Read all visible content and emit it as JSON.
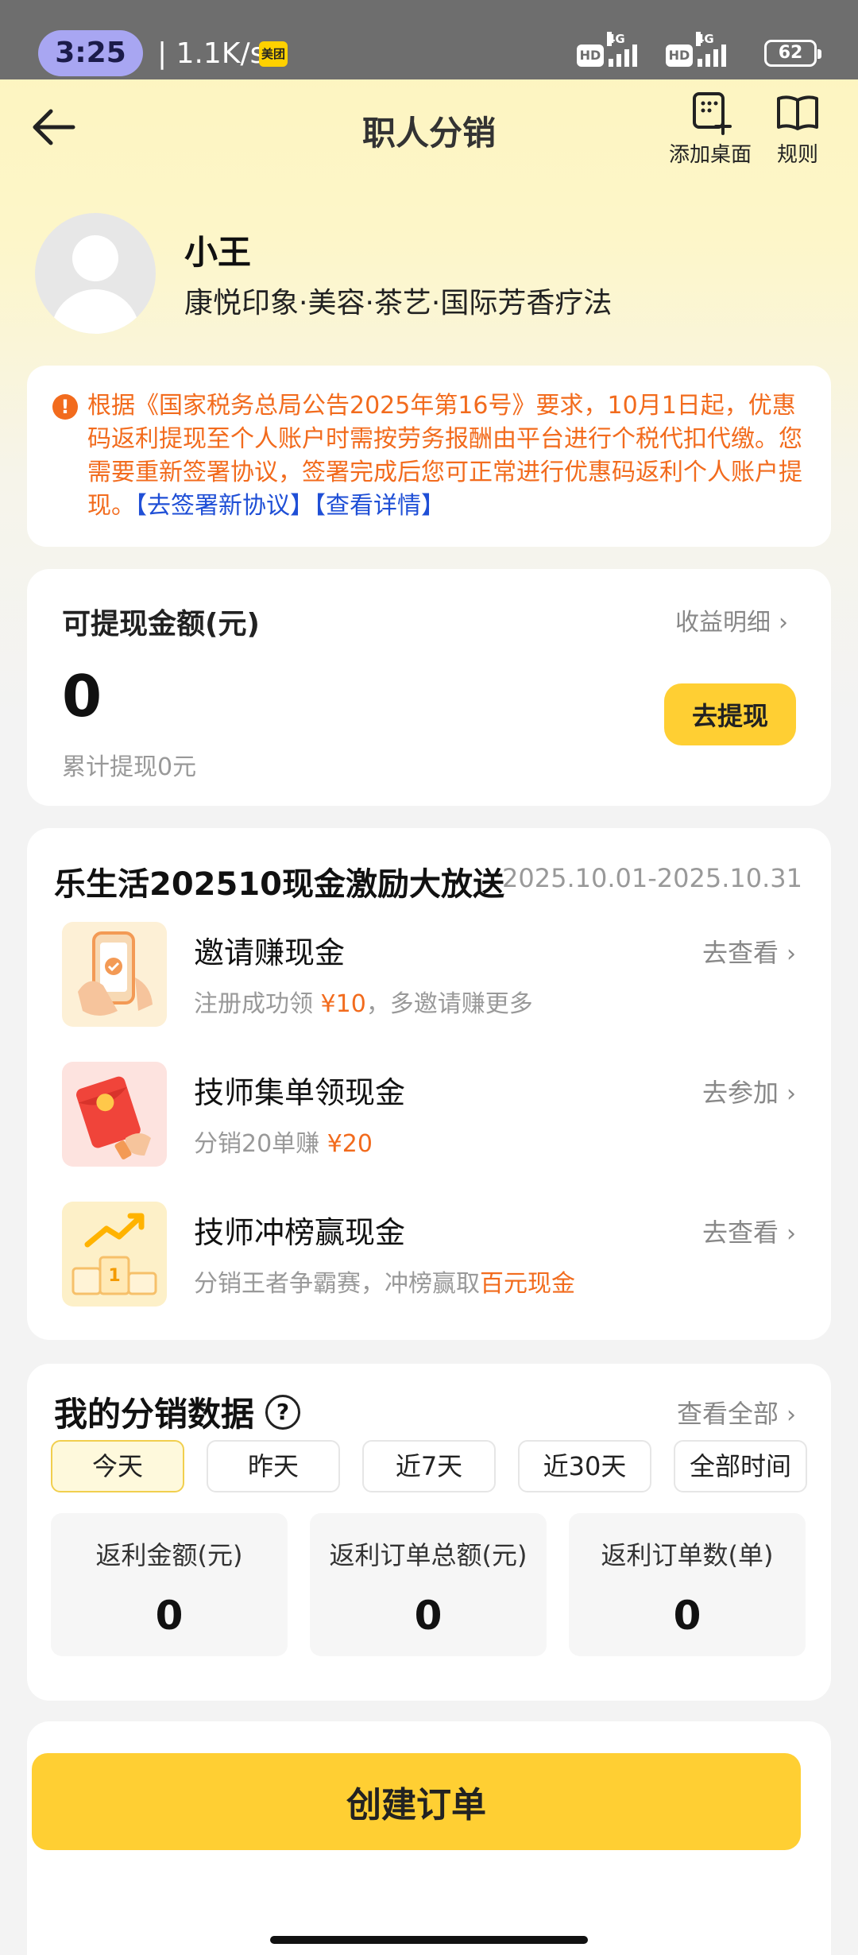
{
  "status_bar": {
    "time": "3:25",
    "net_speed": "1.1K/s",
    "app_badge": "美团",
    "hd_label": "HD",
    "network_label": "4G",
    "battery": "62"
  },
  "header": {
    "title": "职人分销",
    "add_desktop_label": "添加桌面",
    "rules_label": "规则"
  },
  "profile": {
    "name": "小王",
    "tags": "康悦印象·美容·茶艺·国际芳香疗法"
  },
  "notice": {
    "text": "根据《国家税务总局公告2025年第16号》要求，10月1日起，优惠码返利提现至个人账户时需按劳务报酬由平台进行个税代扣代缴。您需要重新签署协议，签署完成后您可正常进行优惠码返利个人账户提现。",
    "sign_link": "【去签署新协议】",
    "detail_link": "【查看详情】"
  },
  "withdraw": {
    "title": "可提现金额(元)",
    "detail_link": "收益明细",
    "amount": "0",
    "total_text": "累计提现0元",
    "button_label": "去提现"
  },
  "campaign": {
    "title": "乐生活202510现金激励大放送",
    "date_range": "2025.10.01-2025.10.31",
    "items": [
      {
        "name": "邀请赚现金",
        "desc_prefix": "注册成功领 ",
        "desc_highlight": "¥10",
        "desc_suffix": "，多邀请赚更多",
        "action": "去查看"
      },
      {
        "name": "技师集单领现金",
        "desc_prefix": "分销20单赚 ",
        "desc_highlight": "¥20",
        "desc_suffix": "",
        "action": "去参加"
      },
      {
        "name": "技师冲榜赢现金",
        "desc_prefix": "分销王者争霸赛，冲榜赢取",
        "desc_highlight": "百元现金",
        "desc_suffix": "",
        "action": "去查看"
      }
    ]
  },
  "stats": {
    "title": "我的分销数据",
    "view_all": "查看全部",
    "tabs": [
      "今天",
      "昨天",
      "近7天",
      "近30天",
      "全部时间"
    ],
    "active_tab": "今天",
    "metrics": [
      {
        "label": "返利金额(元)",
        "value": "0"
      },
      {
        "label": "返利订单总额(元)",
        "value": "0"
      },
      {
        "label": "返利订单数(单)",
        "value": "0"
      }
    ]
  },
  "footer": {
    "create_order_label": "创建订单"
  },
  "colors": {
    "accent_yellow": "#ffcf33",
    "warning_orange": "#f26b1d",
    "link_blue": "#1f4fd6"
  }
}
